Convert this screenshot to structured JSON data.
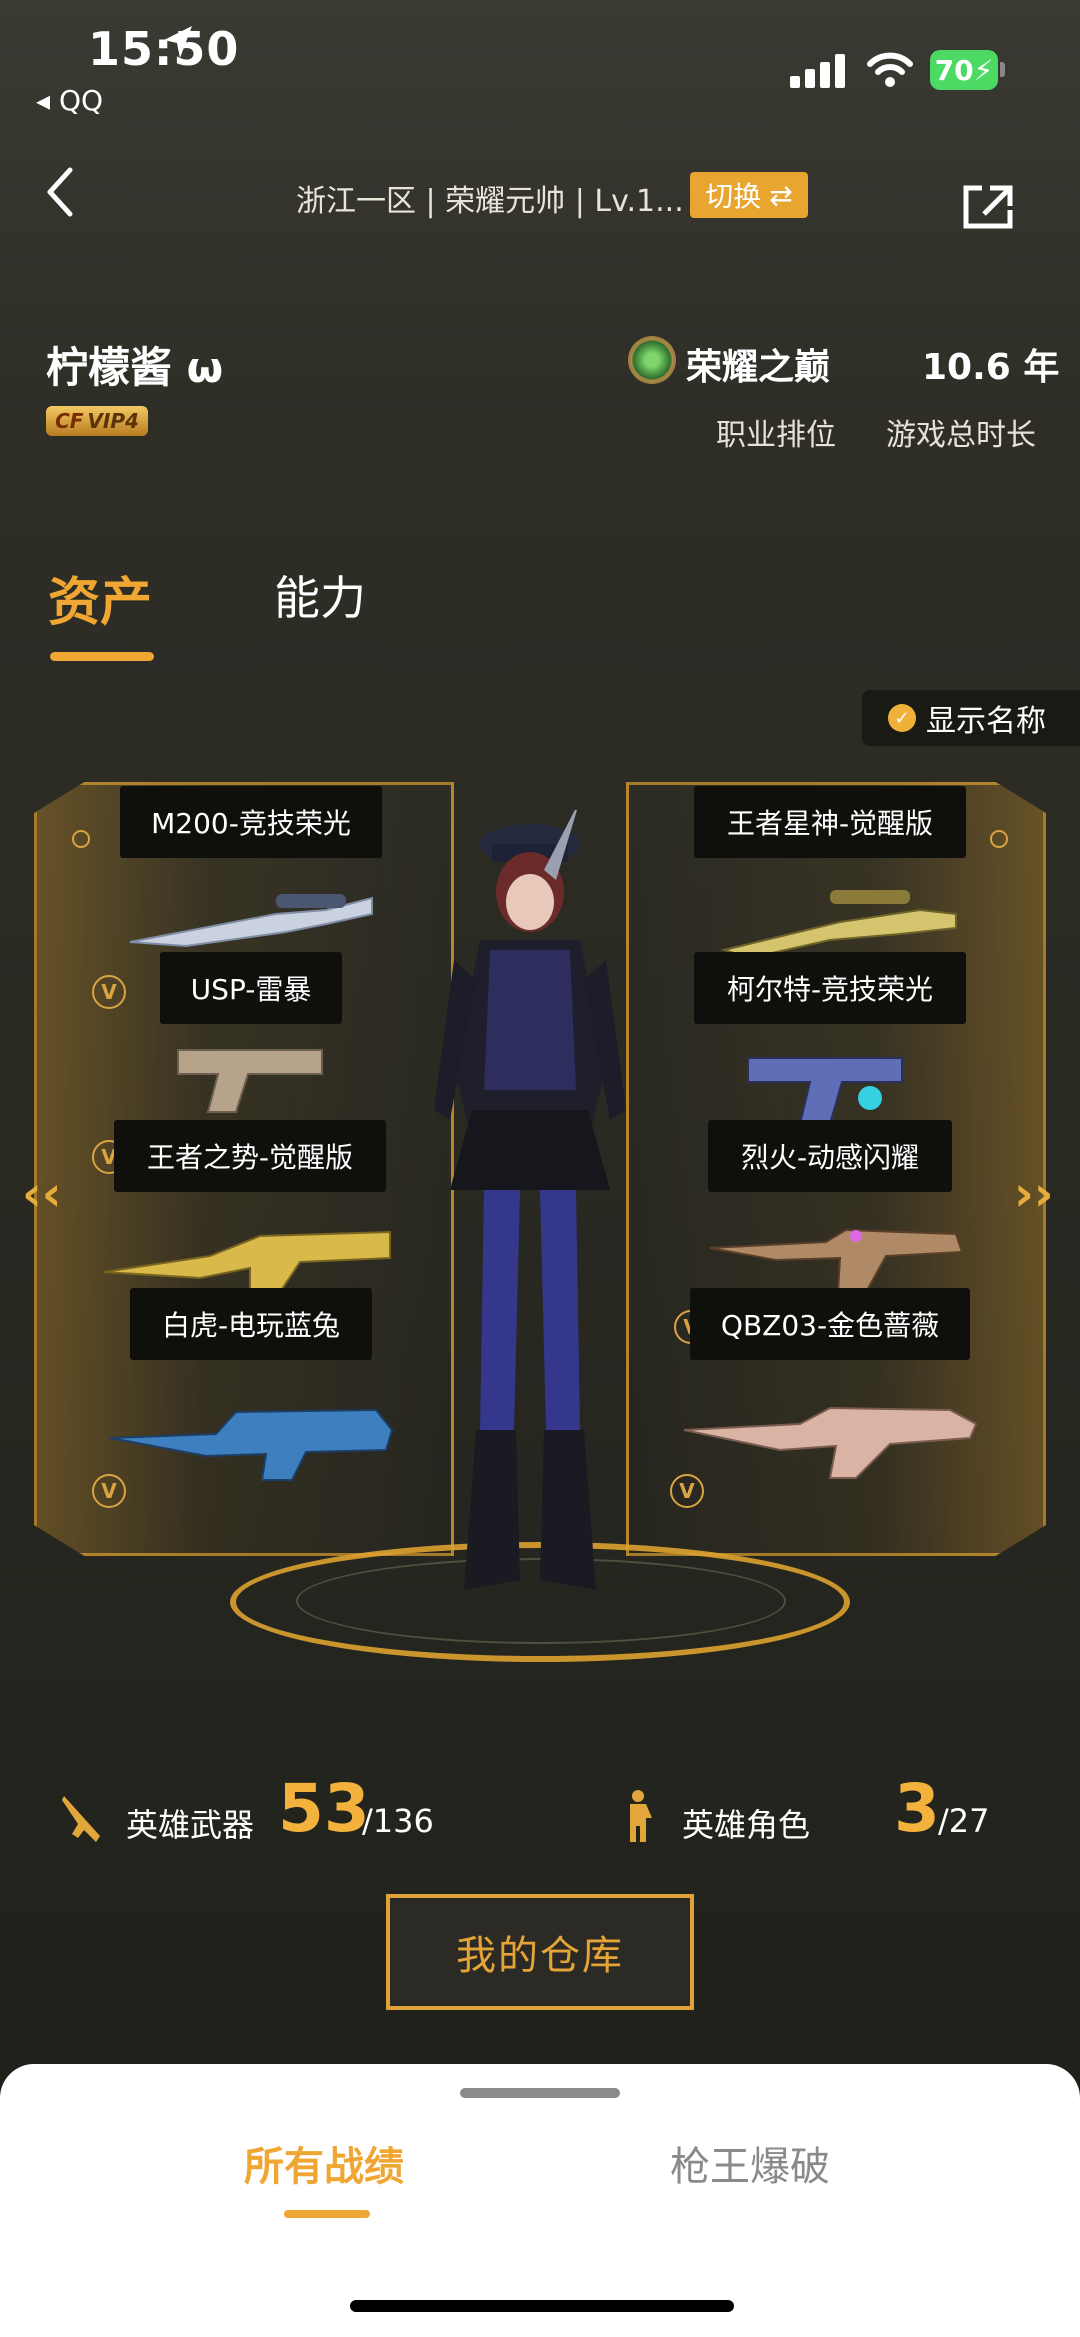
{
  "status_bar": {
    "time": "15:50",
    "back_app": "QQ",
    "battery": "70"
  },
  "header": {
    "title": "浙江一区 | 荣耀元帅 | Lv.1...",
    "switch_label": "切换"
  },
  "profile": {
    "nickname": "柠檬酱 ω",
    "vip": "VIP4",
    "rank_value": "荣耀之巅",
    "rank_label": "职业排位",
    "playtime_value": "10.6 年",
    "playtime_label": "游戏总时长"
  },
  "tabs": [
    {
      "label": "资产",
      "active": true
    },
    {
      "label": "能力",
      "active": false
    }
  ],
  "show_names_label": "显示名称",
  "left_weapons": [
    {
      "name": "M200-竞技荣光"
    },
    {
      "name": "USP-雷暴"
    },
    {
      "name": "王者之势-觉醒版"
    },
    {
      "name": "白虎-电玩蓝兔"
    }
  ],
  "right_weapons": [
    {
      "name": "王者星神-觉醒版"
    },
    {
      "name": "柯尔特-竞技荣光"
    },
    {
      "name": "烈火-动感闪耀"
    },
    {
      "name": "QBZ03-金色蔷薇"
    }
  ],
  "stats": {
    "hero_weapons_label": "英雄武器",
    "hero_weapons_count": "53",
    "hero_weapons_total": "/136",
    "hero_roles_label": "英雄角色",
    "hero_roles_count": "3",
    "hero_roles_total": "/27"
  },
  "warehouse_button": "我的仓库",
  "bottom_tabs": [
    {
      "label": "所有战绩",
      "active": true
    },
    {
      "label": "枪王爆破",
      "active": false
    }
  ],
  "colors": {
    "accent": "#f0a632",
    "panel_gold": "#d89e2d",
    "background": "#2a2a23"
  }
}
